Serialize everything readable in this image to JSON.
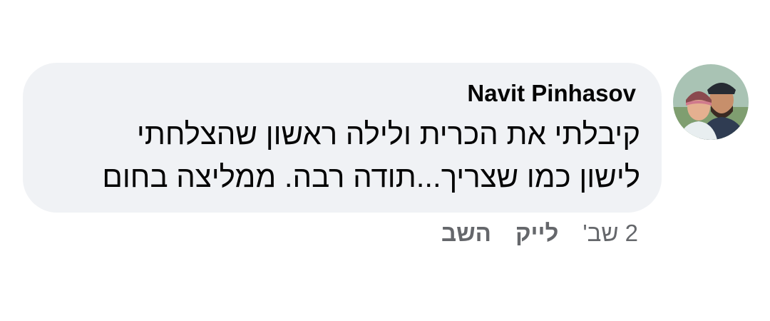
{
  "comment": {
    "author": "Navit Pinhasov",
    "text_lines": [
      "קיבלתי את הכרית ולילה ראשון שהצלחתי",
      "לישון כמו שצריך...תודה רבה. ממליצה בחום"
    ],
    "timestamp": "2 שב'",
    "actions": {
      "like_label": "לייק",
      "reply_label": "השב"
    },
    "avatar_icon": "user-photo-icon"
  },
  "colors": {
    "bubble_background": "#f0f2f5",
    "text_primary": "#050505",
    "text_secondary": "#65676b"
  }
}
